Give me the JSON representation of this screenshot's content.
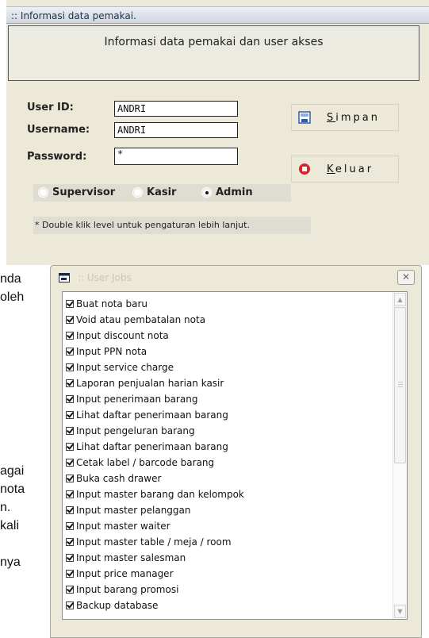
{
  "form_window": {
    "title": ":: Informasi data pemakai.",
    "info_text": "Informasi data pemakai dan user akses",
    "labels": {
      "user_id": "User ID:",
      "username": "Username:",
      "password": "Password:"
    },
    "fields": {
      "user_id": "ANDRI",
      "username": "ANDRI",
      "password": "*"
    },
    "buttons": {
      "simpan": "Simpan",
      "keluar": "Keluar"
    },
    "levels": [
      {
        "label": "Supervisor",
        "selected": false
      },
      {
        "label": "Kasir",
        "selected": false
      },
      {
        "label": "Admin",
        "selected": true
      }
    ],
    "note": "* Double klik level untuk pengaturan lebih lanjut."
  },
  "background_text": [
    "nda",
    "oleh",
    "agai",
    "nota",
    "n.",
    "kali",
    "nya"
  ],
  "jobs_window": {
    "title": ":: User Jobs",
    "close_label": "✕",
    "items": [
      "Buat nota baru",
      "Void atau pembatalan nota",
      "Input discount nota",
      "Input PPN nota",
      "Input service charge",
      "Laporan penjualan harian kasir",
      "Input penerimaan barang",
      "Lihat daftar penerimaan barang",
      "Input pengeluran barang",
      "Lihat daftar penerimaan barang",
      "Cetak label / barcode barang",
      "Buka cash drawer",
      "Input master barang dan kelompok",
      "Input master pelanggan",
      "Input master waiter",
      "Input master table / meja / room",
      "Input master salesman",
      "Input price manager",
      "Input barang promosi",
      "Backup database"
    ]
  },
  "colors": {
    "window_bg": "#ece9d8",
    "save_icon": "#2f5ea8",
    "exit_icon": "#d8262a"
  }
}
